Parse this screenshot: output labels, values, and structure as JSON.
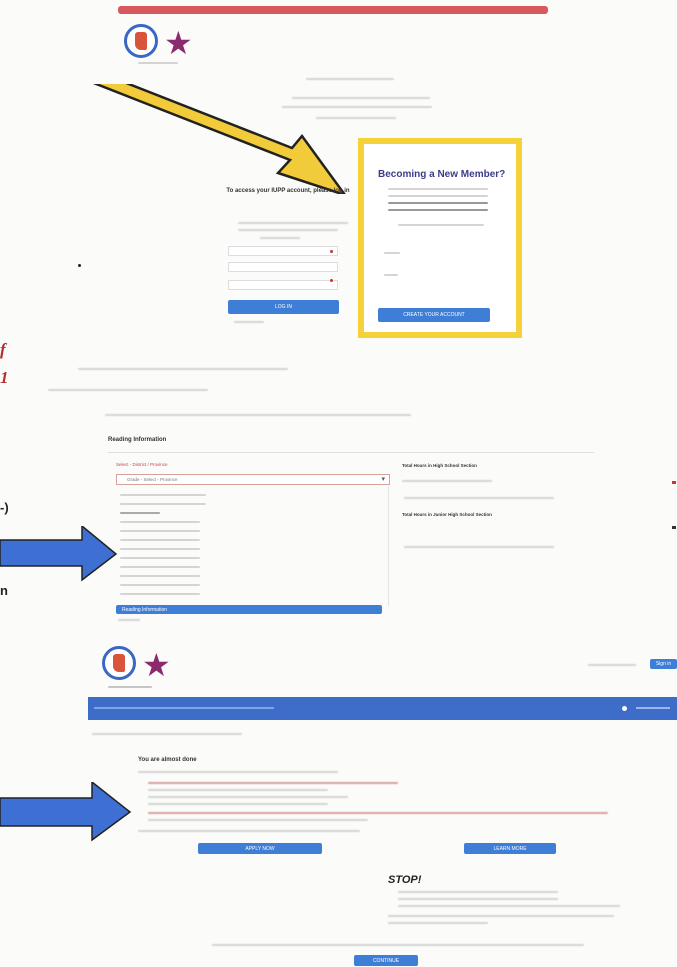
{
  "screens": {
    "login": {
      "member_prompt_title": "Becoming a New Member?",
      "login_heading": "To access your IUPP account, please log in",
      "login_button": "LOG IN",
      "member_button": "CREATE YOUR ACCOUNT"
    },
    "signup": {
      "section_title": "Reading Information",
      "select_label": "Select - District / Province",
      "select_value": "Grade - Select - Province",
      "hours_label": "Total Hours in High School Section",
      "hours_label_2": "Total Hours in Junior High School Section",
      "progress_button": "Reading Information"
    },
    "dashboard": {
      "nav_link": "Sign in",
      "notice_title": "You are almost done",
      "apply_button": "APPLY NOW",
      "learn_button": "LEARN MORE",
      "stop_title": "STOP!",
      "bottom_button": "CONTINUE"
    }
  },
  "annotations": {
    "side_text_1": "f",
    "side_text_2": "1",
    "side_text_3": "-)",
    "side_text_4": "n"
  },
  "colors": {
    "arrow_yellow": "#f2cb3a",
    "arrow_blue": "#3e6fd2",
    "highlight_box": "#f5d23a",
    "brand_blue": "#3d6cc9",
    "top_bar_red": "#d8585e"
  }
}
